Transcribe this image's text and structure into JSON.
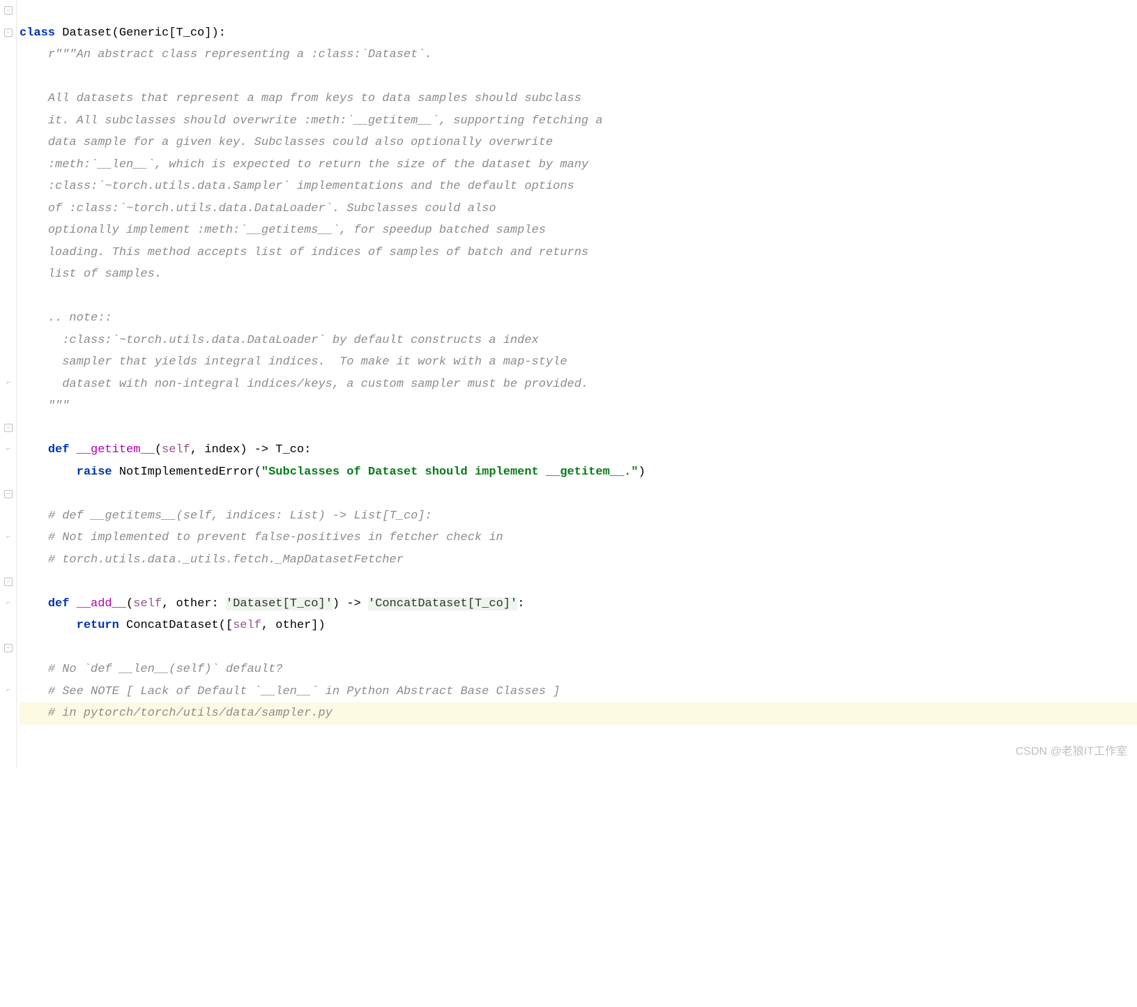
{
  "code": {
    "kw_class": "class",
    "class_name": "Dataset",
    "class_params": "(Generic[T_co]):",
    "doc_open": "r\"\"\"An abstract class representing a :class:`Dataset`.",
    "doc_blank1": "",
    "doc_l1": "All datasets that represent a map from keys to data samples should subclass",
    "doc_l2": "it. All subclasses should overwrite :meth:`__getitem__`, supporting fetching a",
    "doc_l3": "data sample for a given key. Subclasses could also optionally overwrite",
    "doc_l4": ":meth:`__len__`, which is expected to return the size of the dataset by many",
    "doc_l5": ":class:`~torch.utils.data.Sampler` implementations and the default options",
    "doc_l6": "of :class:`~torch.utils.data.DataLoader`. Subclasses could also",
    "doc_l7": "optionally implement :meth:`__getitems__`, for speedup batched samples",
    "doc_l8": "loading. This method accepts list of indices of samples of batch and returns",
    "doc_l9": "list of samples.",
    "doc_blank2": "",
    "doc_note": ".. note::",
    "doc_note1": "  :class:`~torch.utils.data.DataLoader` by default constructs a index",
    "doc_note2": "  sampler that yields integral indices.  To make it work with a map-style",
    "doc_note3": "  dataset with non-integral indices/keys, a custom sampler must be provided.",
    "doc_close": "\"\"\"",
    "kw_def1": "def",
    "fn_getitem": "__getitem__",
    "getitem_sig_open": "(",
    "self1": "self",
    "getitem_sig_rest": ", index) -> T_co:",
    "kw_raise": "raise",
    "exc_name": "NotImplementedError",
    "exc_open": "(",
    "exc_str": "\"Subclasses of Dataset should implement __getitem__.\"",
    "exc_close": ")",
    "cmt1": "# def __getitems__(self, indices: List) -> List[T_co]:",
    "cmt2": "# Not implemented to prevent false-positives in fetcher check in",
    "cmt3": "# torch.utils.data._utils.fetch._MapDatasetFetcher",
    "kw_def2": "def",
    "fn_add": "__add__",
    "add_sig_open": "(",
    "self2": "self",
    "add_sig_mid": ", other: ",
    "add_type1": "'Dataset[T_co]'",
    "add_sig_arrow": ") -> ",
    "add_type2": "'ConcatDataset[T_co]'",
    "add_sig_end": ":",
    "kw_return": "return",
    "ret_call": "ConcatDataset([",
    "self3": "self",
    "ret_rest": ", other])",
    "cmt4": "# No `def __len__(self)` default?",
    "cmt5": "# See NOTE [ Lack of Default `__len__` in Python Abstract Base Classes ]",
    "cmt6": "# in pytorch/torch/utils/data/sampler.py"
  },
  "indent1": "    ",
  "indent2": "        ",
  "watermark": "CSDN @老狼IT工作室"
}
